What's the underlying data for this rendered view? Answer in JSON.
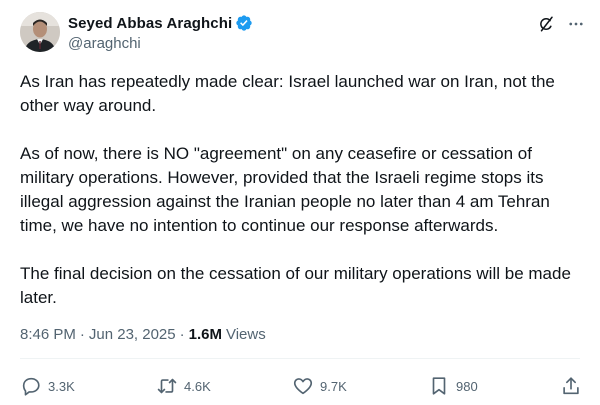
{
  "author": {
    "display_name": "Seyed Abbas Araghchi",
    "handle": "@araghchi",
    "verified": true
  },
  "tweet": {
    "paragraphs": [
      "As Iran has repeatedly made clear: Israel launched war on Iran, not the other way around.",
      "As of now, there is NO \"agreement\" on any ceasefire or cessation of military operations. However, provided that the Israeli regime stops its illegal aggression against the Iranian people no later than 4 am Tehran time, we have no intention to continue our response afterwards.",
      "The final decision on the cessation of our military operations will be made later."
    ],
    "time": "8:46 PM",
    "date": "Jun 23, 2025",
    "separator": "·",
    "views_count": "1.6M",
    "views_label": "Views"
  },
  "actions": {
    "replies": "3.3K",
    "reposts": "4.6K",
    "likes": "9.7K",
    "bookmarks": "980"
  },
  "icons": {
    "verified": "verified-badge-icon",
    "grok": "grok-icon",
    "more": "more-icon",
    "reply": "reply-icon",
    "repost": "repost-icon",
    "like": "heart-icon",
    "bookmark": "bookmark-icon",
    "share": "share-icon"
  },
  "colors": {
    "verified_blue": "#1d9bf0",
    "text_primary": "#0f1419",
    "text_secondary": "#536471"
  }
}
